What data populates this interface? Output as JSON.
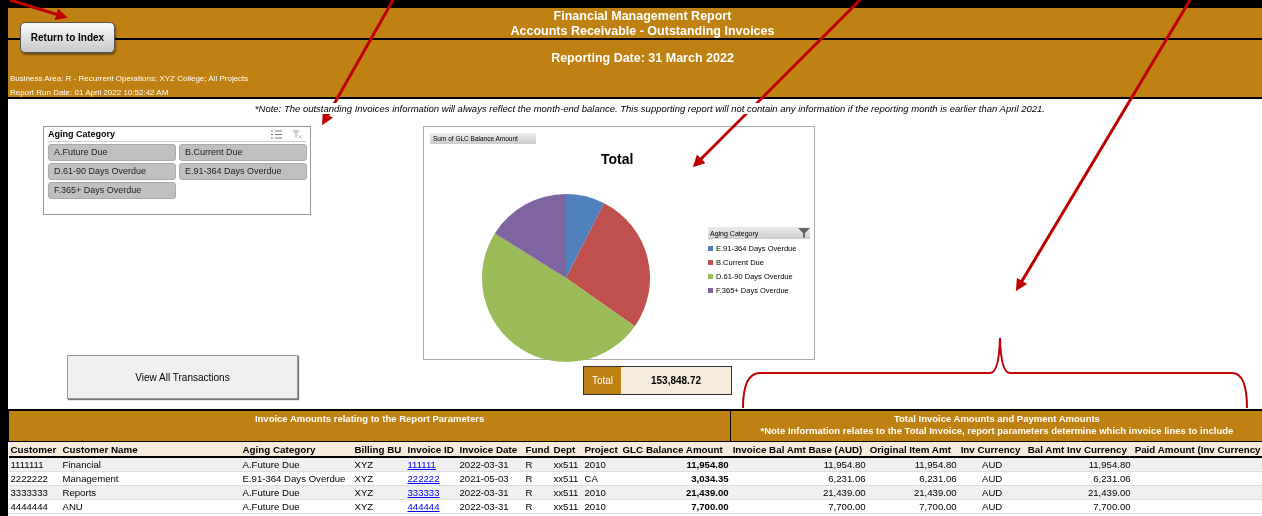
{
  "header": {
    "title_lines": [
      "Financial Management Report",
      "Accounts Receivable - Outstanding Invoices"
    ],
    "reporting_date": "Reporting Date: 31 March 2022",
    "business_area": "Business Area: R - Recurrent Operations; XYZ College; All Projects",
    "run_date": "Report Run Date: 01 April 2022 10:52:42 AM"
  },
  "return_button": "Return to Index",
  "note": "*Note: The outstanding Invoices information will always reflect the month-end balance. This supporting report will not contain any information if the reporting month is earlier than April 2021.",
  "slicer": {
    "title": "Aging Category",
    "items": [
      {
        "label": "A.Future Due",
        "selected": true
      },
      {
        "label": "B.Current Due",
        "selected": true
      },
      {
        "label": "D.61-90 Days Overdue",
        "selected": true
      },
      {
        "label": "E.91-364 Days Overdue",
        "selected": true
      },
      {
        "label": "F.365+ Days Overdue",
        "selected": true
      }
    ]
  },
  "chart": {
    "field_tag": "Sum of GLC Balance Amount",
    "title": "Total",
    "legend_title": "Aging Category",
    "legend": [
      {
        "label": "E.91-364 Days Overdue",
        "color": "#4f81bd"
      },
      {
        "label": "B.Current Due",
        "color": "#c0504d"
      },
      {
        "label": "D.61-90 Days Overdue",
        "color": "#9bbb59"
      },
      {
        "label": "F.365+ Days Overdue",
        "color": "#8064a2"
      }
    ]
  },
  "view_all_button": "View All Transactions",
  "total": {
    "label": "Total",
    "value": "153,848.72"
  },
  "table": {
    "left_heading": "Invoice Amounts relating to the Report Parameters",
    "right_heading": "Total Invoice Amounts and Payment Amounts",
    "right_note": "*Note Information relates to the Total Invoice, report parameters determine which invoice lines to include",
    "columns": [
      {
        "label": "Customer",
        "kind": "text"
      },
      {
        "label": "Customer Name",
        "kind": "text"
      },
      {
        "label": "Aging Category",
        "kind": "text"
      },
      {
        "label": "Billing BU",
        "kind": "text"
      },
      {
        "label": "Invoice ID",
        "kind": "link"
      },
      {
        "label": "Invoice Date",
        "kind": "text"
      },
      {
        "label": "Fund",
        "kind": "text"
      },
      {
        "label": "Dept",
        "kind": "text"
      },
      {
        "label": "Project",
        "kind": "text"
      },
      {
        "label": "GLC Balance Amount",
        "kind": "bold-number"
      },
      {
        "label": "Invoice Bal Amt Base (AUD)",
        "kind": "number"
      },
      {
        "label": "Original Item Amt",
        "kind": "number"
      },
      {
        "label": "Inv Currency",
        "kind": "center"
      },
      {
        "label": "Bal Amt Inv Currency",
        "kind": "number"
      },
      {
        "label": "Paid Amount (Inv Currency",
        "kind": "number"
      }
    ],
    "rows": [
      [
        "1111111",
        "Financial",
        "A.Future Due",
        "XYZ",
        "111111",
        "2022-03-31",
        "R",
        "xx511",
        "2010",
        "11,954.80",
        "11,954.80",
        "11,954.80",
        "AUD",
        "11,954.80",
        null
      ],
      [
        "2222222",
        "Management",
        "E.91-364 Days Overdue",
        "XYZ",
        "222222",
        "2021-05-03",
        "R",
        "xx511",
        "CA",
        "3,034.35",
        "6,231.06",
        "6,231.06",
        "AUD",
        "6,231.06",
        null
      ],
      [
        "3333333",
        "Reports",
        "A.Future Due",
        "XYZ",
        "333333",
        "2022-03-31",
        "R",
        "xx511",
        "2010",
        "21,439.00",
        "21,439.00",
        "21,439.00",
        "AUD",
        "21,439.00",
        null
      ],
      [
        "4444444",
        "ANU",
        "A.Future Due",
        "XYZ",
        "444444",
        "2022-03-31",
        "R",
        "xx511",
        "2010",
        "7,700.00",
        "7,700.00",
        "7,700.00",
        "AUD",
        "7,700.00",
        null
      ]
    ]
  }
}
